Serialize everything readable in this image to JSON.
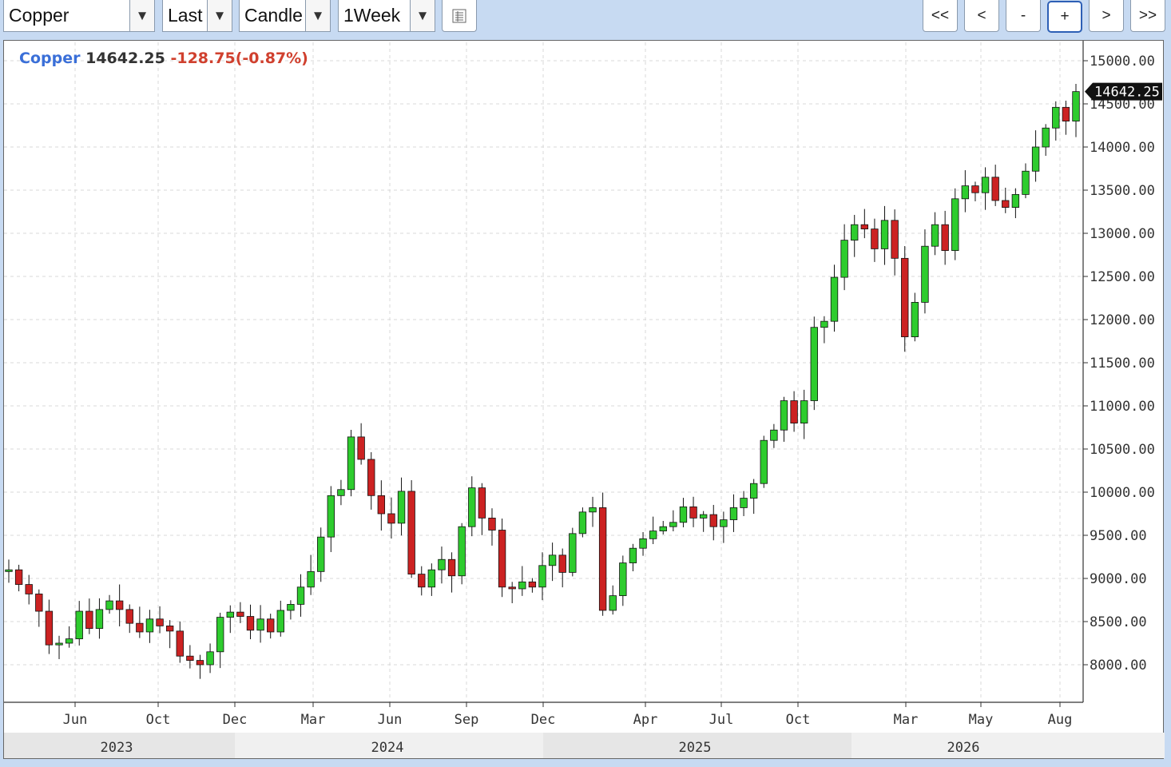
{
  "toolbar": {
    "symbol": "Copper",
    "price_field": "Last",
    "chart_style": "Candle",
    "interval": "1Week",
    "dropdown_arrow": "▼",
    "grid_icon": "list-icon",
    "nav": {
      "first": "<<",
      "prev": "<",
      "zoom_out": "-",
      "zoom_in": "+",
      "next": ">",
      "last": ">>"
    }
  },
  "legend": {
    "symbol": "Copper",
    "last": "14642.25",
    "change": "-128.75(-0.87%)"
  },
  "price_tag": "14642.25",
  "colors": {
    "up": "#2ecc2e",
    "down": "#cc2222",
    "wick": "#111111",
    "accent": "#3a6fd8",
    "change": "#d0402e"
  },
  "chart_data": {
    "type": "candlestick",
    "title": "Copper",
    "interval": "1Week",
    "y_range": [
      7800,
      15200
    ],
    "y_ticks": [
      "15000.00",
      "14500.00",
      "14000.00",
      "13500.00",
      "13000.00",
      "12500.00",
      "12000.00",
      "11500.00",
      "11000.00",
      "10500.00",
      "10000.00",
      "9500.00",
      "9000.00",
      "8500.00",
      "8000.00"
    ],
    "month_labels": [
      "Jun",
      "Oct",
      "Dec",
      "Mar",
      "Jun",
      "Sep",
      "Dec",
      "Apr",
      "Jul",
      "Oct",
      "Mar",
      "May",
      "Aug"
    ],
    "year_labels": [
      "2023",
      "2024",
      "2025",
      "2026"
    ],
    "last_price": 14642.25,
    "grid": true,
    "closes_weekly": [
      9100,
      8930,
      8820,
      8620,
      8230,
      8250,
      8300,
      8620,
      8420,
      8640,
      8740,
      8640,
      8480,
      8380,
      8530,
      8450,
      8390,
      8100,
      8050,
      8000,
      8150,
      8550,
      8610,
      8560,
      8400,
      8530,
      8380,
      8630,
      8700,
      8900,
      9080,
      9480,
      9960,
      10030,
      10640,
      10380,
      9960,
      9750,
      9640,
      10010,
      9050,
      8900,
      9100,
      9220,
      9030,
      9600,
      10050,
      9700,
      9560,
      8900,
      8880,
      8960,
      8900,
      9150,
      9270,
      9070,
      9520,
      9770,
      9820,
      8630,
      8800,
      9180,
      9350,
      9460,
      9550,
      9600,
      9650,
      9830,
      9700,
      9740,
      9600,
      9680,
      9820,
      9930,
      10100,
      10600,
      10720,
      11060,
      10800,
      11060,
      11910,
      11980,
      12490,
      12920,
      13100,
      13050,
      12820,
      13150,
      12710,
      11800,
      12200,
      12850,
      13100,
      12800,
      13400,
      13550,
      13470,
      13650,
      13380,
      13300,
      13450,
      13720,
      14000,
      14220,
      14460,
      14300,
      14642.25
    ]
  }
}
